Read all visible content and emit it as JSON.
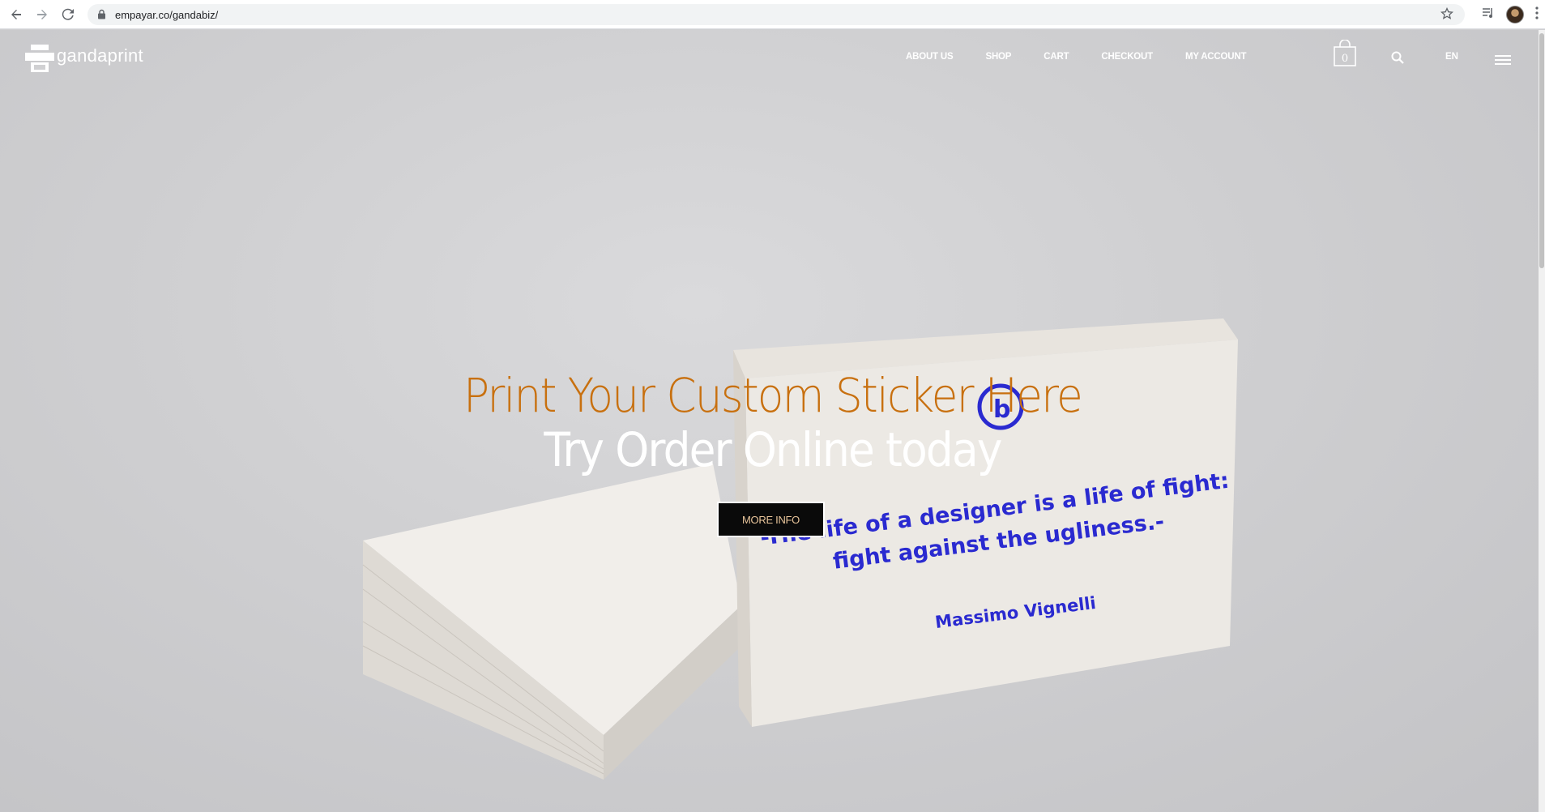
{
  "browser": {
    "url": "empayar.co/gandabiz/",
    "icons": [
      "back-icon",
      "forward-icon",
      "reload-icon",
      "lock-icon",
      "star-icon",
      "media-icon",
      "avatar",
      "menu-icon"
    ]
  },
  "site": {
    "logo_text": "gandaprint",
    "nav": [
      {
        "label": "ABOUT US"
      },
      {
        "label": "SHOP"
      },
      {
        "label": "CART"
      },
      {
        "label": "CHECKOUT"
      },
      {
        "label": "MY ACCOUNT"
      }
    ],
    "cart_count": "0",
    "language": "EN"
  },
  "hero": {
    "title": "Print Your Custom Sticker Here",
    "subtitle": "Try Order Online today",
    "button_label": "MORE INFO",
    "card_quote_line1": "-The life of a designer is a life of fight:",
    "card_quote_line2": "fight against the ugliness.-",
    "card_author": "Massimo Vignelli"
  },
  "colors": {
    "accent": "#c8700f",
    "card_ink": "#2a2ad0",
    "button_bg": "#0a0a0a"
  }
}
